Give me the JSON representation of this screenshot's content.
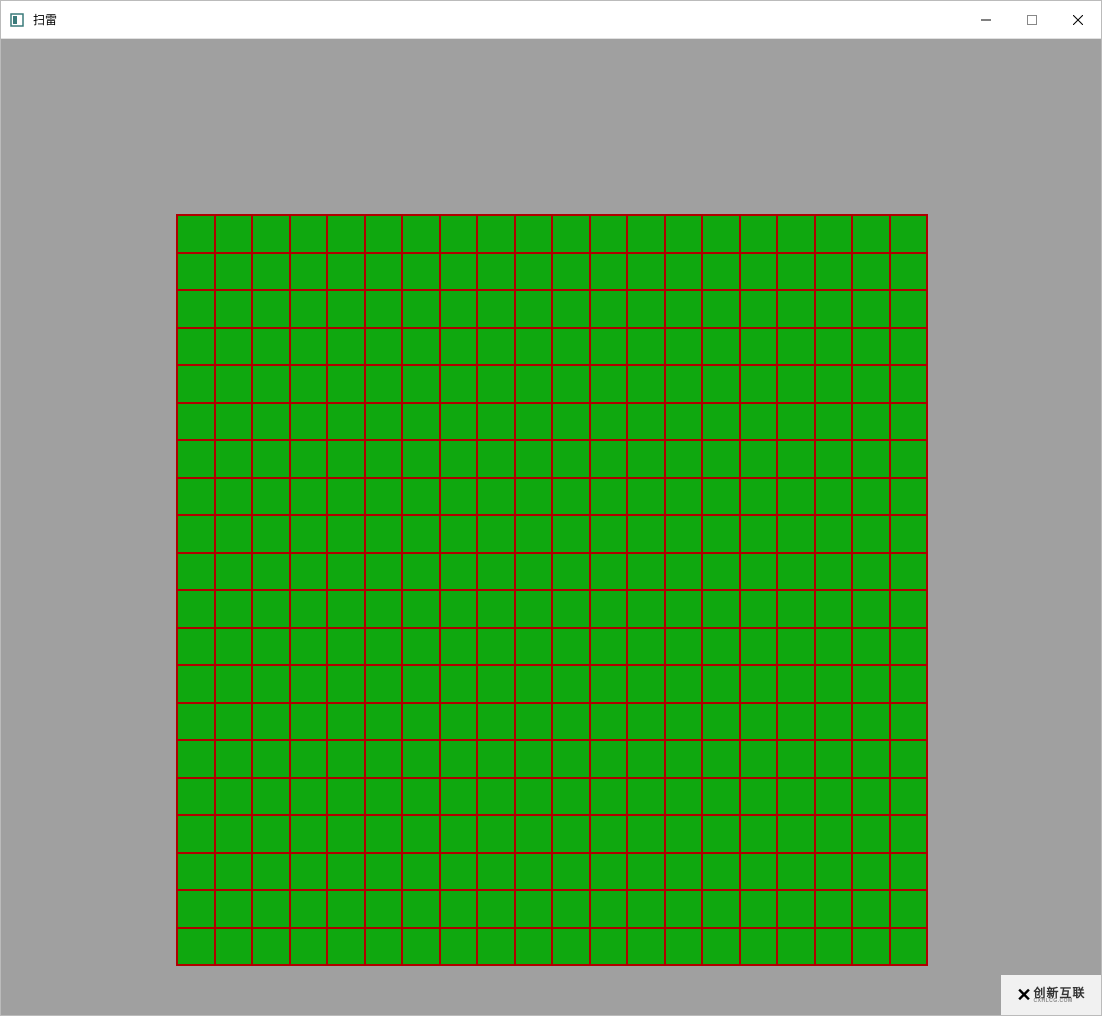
{
  "window": {
    "title": "扫雷"
  },
  "board": {
    "rows": 20,
    "cols": 20,
    "cell_color": "#0fa80f",
    "grid_line_color": "#b00000",
    "background": "#a0a0a0"
  },
  "watermark": {
    "brand_top": "创新互联",
    "brand_bottom": "CXHLCG.COM"
  }
}
